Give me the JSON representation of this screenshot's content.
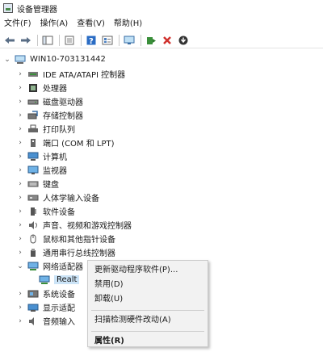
{
  "window": {
    "title": "设备管理器"
  },
  "menubar": [
    "文件(F)",
    "操作(A)",
    "查看(V)",
    "帮助(H)"
  ],
  "toolbar": {
    "buttons": [
      "back-arrow-icon",
      "forward-arrow-icon",
      "show-hide-tree-icon",
      "properties-sheet-icon",
      "help-icon",
      "device-list-icon",
      "monitor-icon",
      "update-driver-icon",
      "uninstall-x-icon",
      "download-arrow-icon"
    ]
  },
  "tree": {
    "root": "WIN10-703131442",
    "items": [
      "IDE ATA/ATAPI 控制器",
      "处理器",
      "磁盘驱动器",
      "存储控制器",
      "打印队列",
      "端口 (COM 和 LPT)",
      "计算机",
      "监视器",
      "键盘",
      "人体学输入设备",
      "软件设备",
      "声音、视频和游戏控制器",
      "鼠标和其他指针设备",
      "通用串行总线控制器",
      "网络适配器",
      "Realt",
      "系统设备",
      "显示适配",
      "音频输入"
    ]
  },
  "context_menu": {
    "items": [
      "更新驱动程序软件(P)...",
      "禁用(D)",
      "卸载(U)",
      "扫描检测硬件改动(A)",
      "属性(R)"
    ]
  },
  "colors": {
    "selection": "#cce4f7",
    "accent_red": "#d0312d",
    "accent_green": "#3a8f3a"
  }
}
